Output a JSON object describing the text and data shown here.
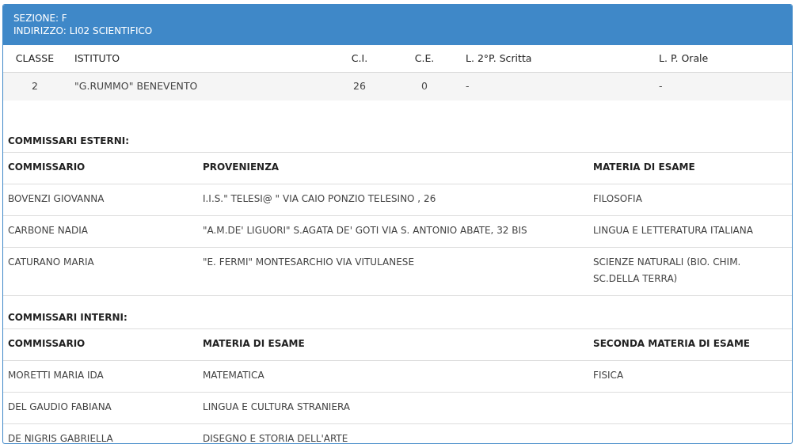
{
  "header": {
    "lines": [
      "SEZIONE: F",
      "INDIRIZZO: LI02 SCIENTIFICO"
    ]
  },
  "classi": {
    "columns": [
      "CLASSE",
      "ISTITUTO",
      "C.I.",
      "C.E.",
      "L. 2°P. Scritta",
      "L. P. Orale"
    ],
    "rows": [
      [
        "2",
        "\"G.RUMMO\" BENEVENTO",
        "26",
        "0",
        "-",
        "-"
      ]
    ]
  },
  "esterni": {
    "title": "COMMISSARI ESTERNI:",
    "columns": [
      "COMMISSARIO",
      "PROVENIENZA",
      "MATERIA DI ESAME"
    ],
    "rows": [
      [
        "BOVENZI GIOVANNA",
        "I.I.S.\" TELESI@ \" VIA CAIO PONZIO TELESINO , 26",
        "FILOSOFIA"
      ],
      [
        "CARBONE NADIA",
        "\"A.M.DE' LIGUORI\" S.AGATA DE' GOTI VIA S. ANTONIO ABATE, 32 BIS",
        "LINGUA E LETTERATURA ITALIANA"
      ],
      [
        "CATURANO MARIA",
        "\"E. FERMI\" MONTESARCHIO VIA VITULANESE",
        "SCIENZE NATURALI (BIO. CHIM. SC.DELLA TERRA)"
      ]
    ]
  },
  "interni": {
    "title": "COMMISSARI INTERNI:",
    "columns": [
      "COMMISSARIO",
      "MATERIA DI ESAME",
      "SECONDA MATERIA DI ESAME"
    ],
    "rows": [
      [
        "MORETTI MARIA IDA",
        "MATEMATICA",
        "FISICA"
      ],
      [
        "DEL GAUDIO FABIANA",
        "LINGUA E CULTURA STRANIERA"
      ],
      [
        "DE NIGRIS GABRIELLA",
        "DISEGNO E STORIA DELL'ARTE"
      ]
    ]
  }
}
